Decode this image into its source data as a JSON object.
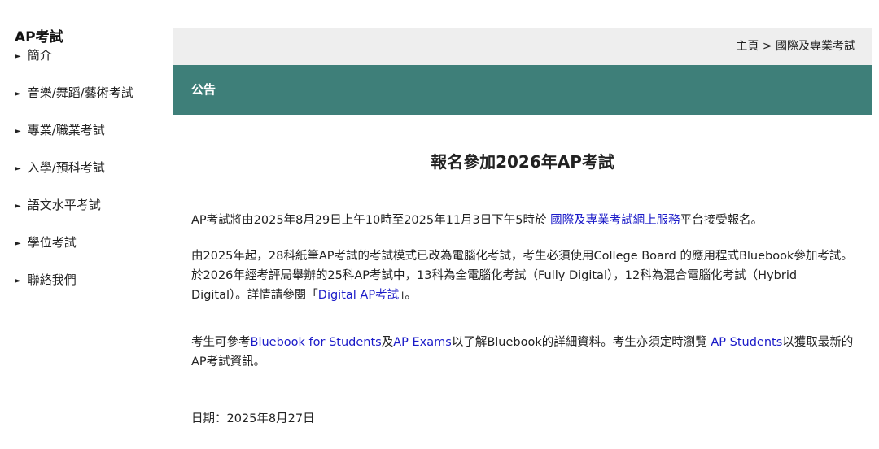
{
  "sidebar": {
    "title": "AP考試",
    "items": [
      {
        "label": "簡介"
      },
      {
        "label": "音樂/舞蹈/藝術考試"
      },
      {
        "label": "專業/職業考試"
      },
      {
        "label": "入學/預科考試"
      },
      {
        "label": "語文水平考試"
      },
      {
        "label": "學位考試"
      },
      {
        "label": "聯絡我們"
      }
    ],
    "bullet": "►"
  },
  "breadcrumb": {
    "home": "主頁",
    "separator": ">",
    "current": "國際及專業考試"
  },
  "notice_bar": {
    "label": "公告",
    "color": "#3e7f79"
  },
  "article": {
    "title": "報名參加2026年AP考試",
    "p1": {
      "before": "AP考試將由2025年8月29日上午10時至2025年11月3日下午5時於 ",
      "link": "國際及專業考試網上服務",
      "after": "平台接受報名。"
    },
    "p2": {
      "text": "由2025年起，28科紙筆AP考試的考試模式已改為電腦化考試，考生必須使用College Board 的應用程式Bluebook參加考試。於2026年經考評局舉辦的25科AP考試中，13科為全電腦化考試（Fully Digital），12科為混合電腦化考試（Hybrid Digital）。詳情請參閱「",
      "link": "Digital AP考試",
      "after": "」。"
    },
    "p3": {
      "before": "考生可參考",
      "link1": "Bluebook for Students",
      "mid1": "及",
      "link2": "AP Exams",
      "mid2": "以了解Bluebook的詳細資料。考生亦須定時瀏覽 ",
      "link3": "AP Students",
      "after": "以獲取最新的AP考試資訊。"
    },
    "date": "日期：2025年8月27日"
  },
  "colors": {
    "link": "#1a1ac8",
    "breadcrumb_bg": "#eeeeee"
  }
}
